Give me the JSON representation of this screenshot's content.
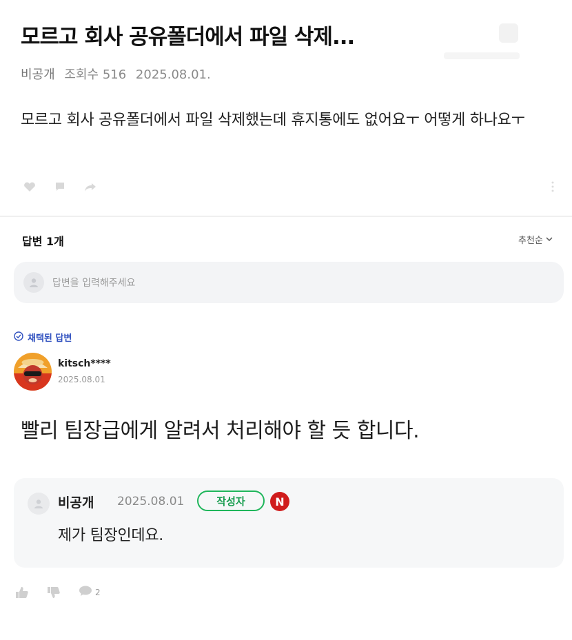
{
  "question": {
    "title": "모르고 회사 공유폴더에서 파일 삭제...",
    "author": "비공개",
    "views": "조회수 516",
    "date": "2025.08.01.",
    "body": "모르고 회사 공유폴더에서 파일 삭제했는데 휴지통에도 없어요ㅜ 어떻게 하나요ㅜ"
  },
  "answers": {
    "header": "답변 1개",
    "sort_label": "추천순",
    "input_placeholder": "답변을 입력해주세요"
  },
  "accepted_answer": {
    "badge": "채택된 답변",
    "user": "kitsch****",
    "date": "2025.08.01",
    "text": "빨리 팀장급에게 알려서 처리해야 할 듯 합니다."
  },
  "reply": {
    "user": "비공개",
    "date": "2025.08.01",
    "author_badge": "작성자",
    "n_badge": "N",
    "text": "제가 팀장인데요."
  },
  "footer": {
    "comment_count": "2"
  },
  "colors": {
    "accent_blue": "#2e4fbf",
    "author_green": "#1fb65b",
    "n_red": "#d01c1c",
    "icon_gray": "#c9c9c9"
  }
}
